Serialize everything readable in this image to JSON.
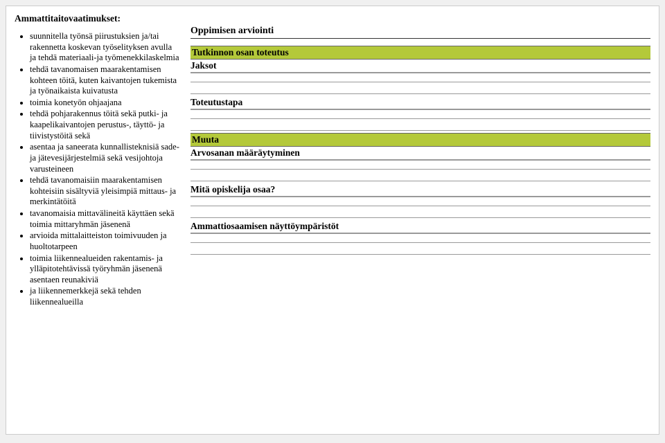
{
  "left": {
    "title": "Ammattitaitovaatimukset:",
    "items": [
      "suunnitella työnsä piirustuksien ja/tai rakennetta koskevan työselityksen avulla ja tehdä materiaali-ja työmenekkilaskelmia",
      "tehdä tavanomaisen maarakentamisen kohteen töitä, kuten kaivantojen tukemista ja työnaikaista kuivatusta",
      "toimia konetyön ohjaajana",
      "tehdä pohjarakennus töitä sekä putki- ja kaapelikaivantojen perustus-, täyttö- ja tiivistystöitä sekä",
      "asentaa ja saneerata kunnallisteknisiä sade- ja jätevesijärjestelmiä sekä vesijohtoja varusteineen",
      "tehdä tavanomaisiin maarakentamisen kohteisiin sisältyviä yleisimpiä mittaus- ja merkintätöitä",
      "tavanomaisia mittavälineitä käyttäen sekä toimia mittaryhmän jäsenenä",
      "arvioida mittalaitteiston toimivuuden ja huoltotarpeen",
      "toimia liikennealueiden rakentamis- ja ylläpitotehtävissä työryhmän jäsenenä asentaen reunakiviä",
      "ja liikennemerkkejä sekä tehden liikennealueilla"
    ]
  },
  "right": {
    "h1": "Oppimisen arviointi",
    "h2_a": "Tutkinnon osan toteutus",
    "sub_a": "Jaksot",
    "sub_b": "Toteutustapa",
    "h2_b": "Muuta",
    "sub_c": "Arvosanan määräytyminen",
    "sub_d": "Mitä opiskelija osaa?",
    "sub_e": "Ammattiosaamisen näyttöympäristöt"
  }
}
